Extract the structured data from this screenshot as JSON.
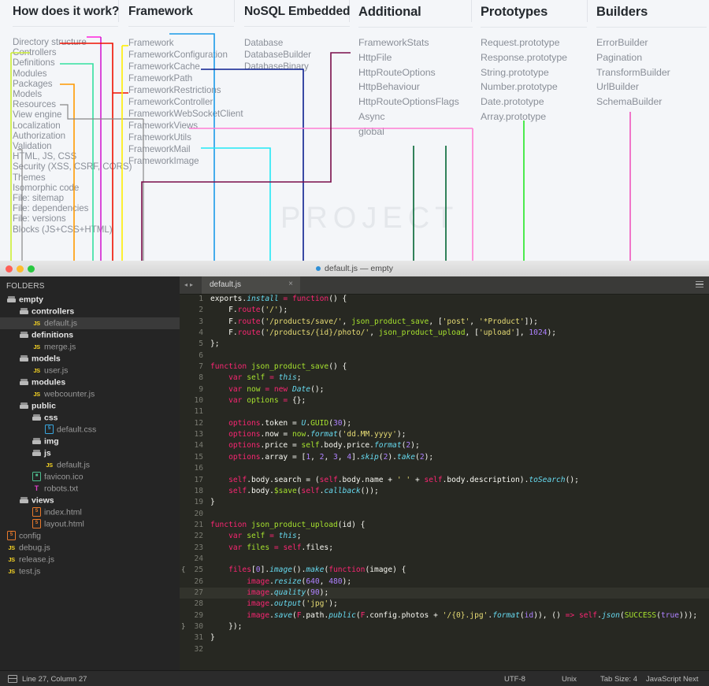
{
  "doc": {
    "watermark": "PROJECT",
    "columns": [
      {
        "id": "how-does-it-work",
        "title": "How does it work?",
        "items": [
          "Directory structure",
          "Controllers",
          "Definitions",
          "Modules",
          "Packages",
          "Models",
          "Resources",
          "View engine",
          "Localization",
          "Authorization",
          "Validation",
          "HTML, JS, CSS",
          "Security (XSS, CSRF, CORS)",
          "Themes",
          "Isomorphic code",
          "File: sitemap",
          "File: dependencies",
          "File: versions",
          "Blocks (JS+CSS+HTML)"
        ]
      },
      {
        "id": "framework",
        "title": "Framework",
        "items": [
          "Framework",
          "FrameworkConfiguration",
          "FrameworkCache",
          "FrameworkPath",
          "FrameworkRestrictions",
          "FrameworkController",
          "FrameworkWebSocketClient",
          "FrameworkViews",
          "FrameworkUtils",
          "FrameworkMail",
          "FrameworkImage"
        ]
      },
      {
        "id": "nosql-embedded",
        "title": "NoSQL Embedded",
        "items": [
          "Database",
          "DatabaseBuilder",
          "DatabaseBinary"
        ]
      },
      {
        "id": "additional",
        "title": "Additional",
        "items": [
          "FrameworkStats",
          "HttpFile",
          "HttpRouteOptions",
          "HttpBehaviour",
          "HttpRouteOptionsFlags",
          "Async",
          "global"
        ]
      },
      {
        "id": "prototypes",
        "title": "Prototypes",
        "items": [
          "Request.prototype",
          "Response.prototype",
          "String.prototype",
          "Number.prototype",
          "Date.prototype",
          "Array.prototype"
        ]
      },
      {
        "id": "builders",
        "title": "Builders",
        "items": [
          "ErrorBuilder",
          "Pagination",
          "TransformBuilder",
          "UrlBuilder",
          "SchemaBuilder"
        ]
      }
    ]
  },
  "editor": {
    "window_title": "default.js — empty",
    "sidebar_header": "FOLDERS",
    "tab": {
      "name": "default.js",
      "close": "×"
    },
    "tree": [
      {
        "label": "empty",
        "type": "folder",
        "depth": 0
      },
      {
        "label": "controllers",
        "type": "folder",
        "depth": 1
      },
      {
        "label": "default.js",
        "type": "js",
        "depth": 2,
        "selected": true
      },
      {
        "label": "definitions",
        "type": "folder",
        "depth": 1
      },
      {
        "label": "merge.js",
        "type": "js",
        "depth": 2
      },
      {
        "label": "models",
        "type": "folder",
        "depth": 1
      },
      {
        "label": "user.js",
        "type": "js",
        "depth": 2
      },
      {
        "label": "modules",
        "type": "folder",
        "depth": 1
      },
      {
        "label": "webcounter.js",
        "type": "js",
        "depth": 2
      },
      {
        "label": "public",
        "type": "folder",
        "depth": 1
      },
      {
        "label": "css",
        "type": "folder",
        "depth": 2
      },
      {
        "label": "default.css",
        "type": "css",
        "depth": 3
      },
      {
        "label": "img",
        "type": "folder",
        "depth": 2
      },
      {
        "label": "js",
        "type": "folder",
        "depth": 2
      },
      {
        "label": "default.js",
        "type": "js",
        "depth": 3
      },
      {
        "label": "favicon.ico",
        "type": "img",
        "depth": 2
      },
      {
        "label": "robots.txt",
        "type": "txt",
        "depth": 2
      },
      {
        "label": "views",
        "type": "folder",
        "depth": 1
      },
      {
        "label": "index.html",
        "type": "html",
        "depth": 2
      },
      {
        "label": "layout.html",
        "type": "html",
        "depth": 2
      },
      {
        "label": "config",
        "type": "html",
        "depth": 0
      },
      {
        "label": "debug.js",
        "type": "js",
        "depth": 0
      },
      {
        "label": "release.js",
        "type": "js",
        "depth": 0
      },
      {
        "label": "test.js",
        "type": "js",
        "depth": 0
      }
    ],
    "code_lines": [
      {
        "n": 1,
        "html": "<span class=\"pl\">exports.</span><span class=\"bi\">install</span><span class=\"op\"> = </span><span class=\"kw\">function</span><span class=\"pl\">() {</span>"
      },
      {
        "n": 2,
        "html": "    <span class=\"pl\">F.</span><span class=\"kw\">route</span><span class=\"pl\">(</span><span class=\"st\">'/'</span><span class=\"pl\">);</span>"
      },
      {
        "n": 3,
        "html": "    <span class=\"pl\">F.</span><span class=\"kw\">route</span><span class=\"pl\">(</span><span class=\"st\">'/products/save/'</span><span class=\"pl\">, </span><span class=\"fn\">json_product_save</span><span class=\"pl\">, [</span><span class=\"st\">'post'</span><span class=\"pl\">, </span><span class=\"st\">'*Product'</span><span class=\"pl\">]);</span>"
      },
      {
        "n": 4,
        "html": "    <span class=\"pl\">F.</span><span class=\"kw\">route</span><span class=\"pl\">(</span><span class=\"st\">'/products/{id}/photo/'</span><span class=\"pl\">, </span><span class=\"fn\">json_product_upload</span><span class=\"pl\">, [</span><span class=\"st\">'upload'</span><span class=\"pl\">], </span><span class=\"nm\">1024</span><span class=\"pl\">);</span>"
      },
      {
        "n": 5,
        "html": "<span class=\"pl\">};</span>"
      },
      {
        "n": 6,
        "html": ""
      },
      {
        "n": 7,
        "html": "<span class=\"kw\">function</span><span class=\"pl\"> </span><span class=\"fn\">json_product_save</span><span class=\"pl\">() {</span>"
      },
      {
        "n": 8,
        "html": "    <span class=\"kw\">var</span><span class=\"pl\"> </span><span class=\"fn\">self</span><span class=\"op\"> = </span><span class=\"bi\">this</span><span class=\"pl\">;</span>"
      },
      {
        "n": 9,
        "html": "    <span class=\"kw\">var</span><span class=\"pl\"> </span><span class=\"fn\">now</span><span class=\"op\"> = </span><span class=\"kw\">new</span><span class=\"pl\"> </span><span class=\"bi\">Date</span><span class=\"pl\">();</span>"
      },
      {
        "n": 10,
        "html": "    <span class=\"kw\">var</span><span class=\"pl\"> </span><span class=\"fn\">options</span><span class=\"op\"> = </span><span class=\"pl\">{};</span>"
      },
      {
        "n": 11,
        "html": ""
      },
      {
        "n": 12,
        "html": "    <span class=\"kw\">options</span><span class=\"pl\">.token = </span><span class=\"bi\">U</span><span class=\"pl\">.</span><span class=\"fn\">GUID</span><span class=\"pl\">(</span><span class=\"nm\">30</span><span class=\"pl\">);</span>"
      },
      {
        "n": 13,
        "html": "    <span class=\"kw\">options</span><span class=\"pl\">.now = </span><span class=\"fn\">now</span><span class=\"pl\">.</span><span class=\"bi\">format</span><span class=\"pl\">(</span><span class=\"st\">'dd.MM.yyyy'</span><span class=\"pl\">);</span>"
      },
      {
        "n": 14,
        "html": "    <span class=\"kw\">options</span><span class=\"pl\">.price = </span><span class=\"fn\">self</span><span class=\"pl\">.body.price.</span><span class=\"bi\">format</span><span class=\"pl\">(</span><span class=\"nm\">2</span><span class=\"pl\">);</span>"
      },
      {
        "n": 15,
        "html": "    <span class=\"kw\">options</span><span class=\"pl\">.array = [</span><span class=\"nm\">1</span><span class=\"pl\">, </span><span class=\"nm\">2</span><span class=\"pl\">, </span><span class=\"nm\">3</span><span class=\"pl\">, </span><span class=\"nm\">4</span><span class=\"pl\">].</span><span class=\"bi\">skip</span><span class=\"pl\">(</span><span class=\"nm\">2</span><span class=\"pl\">).</span><span class=\"bi\">take</span><span class=\"pl\">(</span><span class=\"nm\">2</span><span class=\"pl\">);</span>"
      },
      {
        "n": 16,
        "html": ""
      },
      {
        "n": 17,
        "html": "    <span class=\"kw\">self</span><span class=\"pl\">.body.search = (</span><span class=\"kw\">self</span><span class=\"pl\">.body.name + </span><span class=\"st\">' '</span><span class=\"pl\"> + </span><span class=\"kw\">self</span><span class=\"pl\">.body.description).</span><span class=\"bi\">toSearch</span><span class=\"pl\">();</span>"
      },
      {
        "n": 18,
        "html": "    <span class=\"kw\">self</span><span class=\"pl\">.body.</span><span class=\"fn\">$save</span><span class=\"pl\">(</span><span class=\"kw\">self</span><span class=\"pl\">.</span><span class=\"bi\">callback</span><span class=\"pl\">());</span>"
      },
      {
        "n": 19,
        "html": "<span class=\"pl\">}</span>"
      },
      {
        "n": 20,
        "html": ""
      },
      {
        "n": 21,
        "html": "<span class=\"kw\">function</span><span class=\"pl\"> </span><span class=\"fn\">json_product_upload</span><span class=\"pl\">(id) {</span>"
      },
      {
        "n": 22,
        "html": "    <span class=\"kw\">var</span><span class=\"pl\"> </span><span class=\"fn\">self</span><span class=\"op\"> = </span><span class=\"bi\">this</span><span class=\"pl\">;</span>"
      },
      {
        "n": 23,
        "html": "    <span class=\"kw\">var</span><span class=\"pl\"> </span><span class=\"fn\">files</span><span class=\"op\"> = </span><span class=\"kw\">self</span><span class=\"pl\">.files;</span>"
      },
      {
        "n": 24,
        "html": ""
      },
      {
        "n": 25,
        "html": "    <span class=\"kw\">files</span><span class=\"pl\">[</span><span class=\"nm\">0</span><span class=\"pl\">].</span><span class=\"bi\">image</span><span class=\"pl\">().</span><span class=\"bi\">make</span><span class=\"pl\">(</span><span class=\"kw\">function</span><span class=\"pl\">(image) {</span>",
        "fold": "{"
      },
      {
        "n": 26,
        "html": "        <span class=\"kw\">image</span><span class=\"pl\">.</span><span class=\"bi\">resize</span><span class=\"pl\">(</span><span class=\"nm\">640</span><span class=\"pl\">, </span><span class=\"nm\">480</span><span class=\"pl\">);</span>"
      },
      {
        "n": 27,
        "html": "        <span class=\"kw\">image</span><span class=\"pl\">.</span><span class=\"bi\">quality</span><span class=\"pl\">(</span><span class=\"nm\">90</span><span class=\"pl\">);</span>",
        "hl": true
      },
      {
        "n": 28,
        "html": "        <span class=\"kw\">image</span><span class=\"pl\">.</span><span class=\"bi\">output</span><span class=\"pl\">(</span><span class=\"st\">'jpg'</span><span class=\"pl\">);</span>"
      },
      {
        "n": 29,
        "html": "        <span class=\"kw\">image</span><span class=\"pl\">.</span><span class=\"bi\">save</span><span class=\"pl\">(</span><span class=\"kw\">F</span><span class=\"pl\">.path.</span><span class=\"bi\">public</span><span class=\"pl\">(</span><span class=\"kw\">F</span><span class=\"pl\">.config.photos + </span><span class=\"st\">'/{0}.jpg'</span><span class=\"pl\">.</span><span class=\"bi\">format</span><span class=\"pl\">(</span><span class=\"nm\">id</span><span class=\"pl\">)), () </span><span class=\"op\">=&gt;</span><span class=\"pl\"> </span><span class=\"kw\">self</span><span class=\"pl\">.</span><span class=\"bi\">json</span><span class=\"pl\">(</span><span class=\"fn\">SUCCESS</span><span class=\"pl\">(</span><span class=\"nm\">true</span><span class=\"pl\">)));</span>"
      },
      {
        "n": 30,
        "html": "    <span class=\"pl\">});</span>",
        "fold": "}"
      },
      {
        "n": 31,
        "html": "<span class=\"pl\">}</span>"
      },
      {
        "n": 32,
        "html": ""
      }
    ],
    "status": {
      "cursor": "Line 27, Column 27",
      "encoding": "UTF-8",
      "line_endings": "Unix",
      "tab_size": "Tab Size: 4",
      "syntax": "JavaScript Next"
    }
  },
  "colors": {
    "magenta": "#ff22dd",
    "red": "#ee1100",
    "orange": "#ff9900",
    "yellow_green": "#ccee33",
    "spring_green": "#33e0a0",
    "yellow": "#ffee00",
    "gray": "#888888",
    "dodger_blue": "#1a9ae8",
    "navy": "#0b1f8f",
    "cyan": "#22e8f5",
    "pink": "#ff7fd4",
    "maroon": "#7a0d4a",
    "green": "#00b050",
    "bright_green": "#22e822",
    "hot_pink": "#ee55bb"
  }
}
